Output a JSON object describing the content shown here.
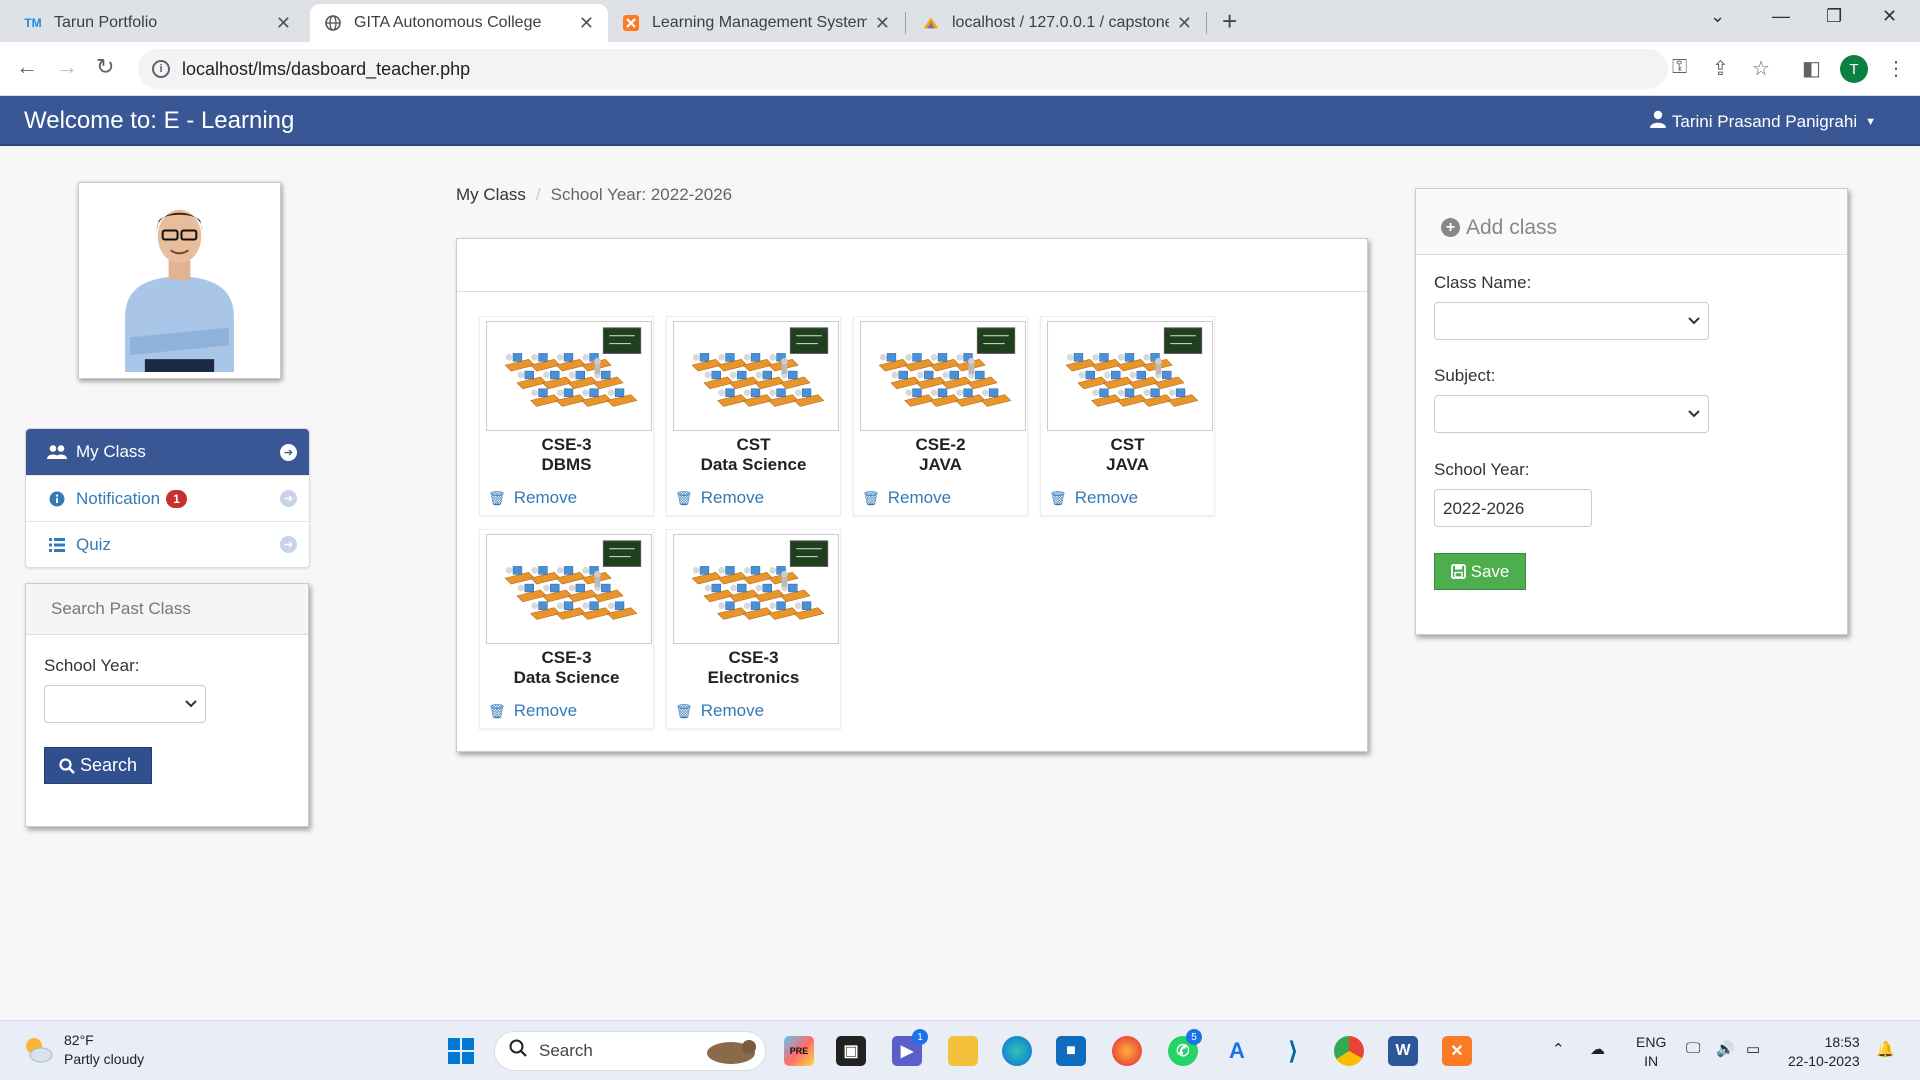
{
  "browser": {
    "tabs": [
      {
        "title": "Tarun Portfolio",
        "favicon": "TM"
      },
      {
        "title": "GITA Autonomous College",
        "favicon": "globe"
      },
      {
        "title": "Learning Management System",
        "favicon": "xampp"
      },
      {
        "title": "localhost / 127.0.0.1 / capstone",
        "favicon": "pma"
      }
    ],
    "url": "localhost/lms/dasboard_teacher.php",
    "profile_initial": "T"
  },
  "app": {
    "brand": "Welcome to: E - Learning",
    "user_name": "Tarini Prasand Panigrahi",
    "header_color": "#3a5795"
  },
  "sidebar": {
    "items": [
      {
        "label": "My Class",
        "icon": "users-icon",
        "active": true
      },
      {
        "label": "Notification",
        "icon": "info-icon",
        "badge": "1"
      },
      {
        "label": "Quiz",
        "icon": "list-icon"
      }
    ],
    "search_panel": {
      "title": "Search Past Class",
      "school_year_label": "School Year:",
      "school_year_value": "",
      "search_label": "Search"
    }
  },
  "breadcrumb": {
    "current": "My Class",
    "school_year": "School Year: 2022-2026"
  },
  "classes": [
    {
      "section": "CSE-3",
      "subject": "DBMS",
      "remove": "Remove"
    },
    {
      "section": "CST",
      "subject": "Data Science",
      "remove": "Remove"
    },
    {
      "section": "CSE-2",
      "subject": "JAVA",
      "remove": "Remove"
    },
    {
      "section": "CST",
      "subject": "JAVA",
      "remove": "Remove"
    },
    {
      "section": "CSE-3",
      "subject": "Data Science",
      "remove": "Remove"
    },
    {
      "section": "CSE-3",
      "subject": "Electronics",
      "remove": "Remove"
    }
  ],
  "add_class": {
    "title": "Add class",
    "class_name_label": "Class Name:",
    "class_name_value": "",
    "subject_label": "Subject:",
    "subject_value": "",
    "school_year_label": "School Year:",
    "school_year_value": "2022-2026",
    "save_label": "Save"
  },
  "taskbar": {
    "weather_temp": "82°F",
    "weather_desc": "Partly cloudy",
    "search_placeholder": "Search",
    "teams_badge": "1",
    "whatsapp_badge": "5",
    "lang_1": "ENG",
    "lang_2": "IN",
    "time": "18:53",
    "date": "22-10-2023"
  }
}
